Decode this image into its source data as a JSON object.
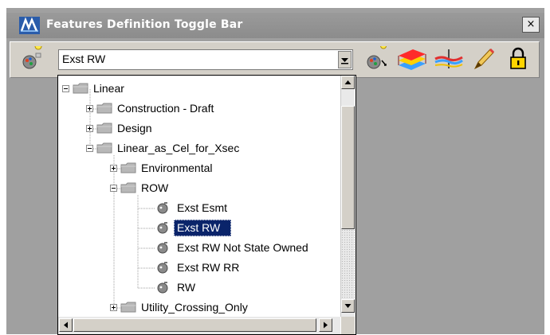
{
  "window": {
    "title": "Features Definition Toggle Bar",
    "close_label": "×"
  },
  "toolbar": {
    "feature_selector": {
      "value": "Exst RW"
    },
    "icons": [
      "feature-picker-icon",
      "feature-options-icon",
      "layers-icon",
      "cross-section-icon",
      "linear-pencil-icon",
      "lock-icon"
    ]
  },
  "tree": {
    "items": [
      {
        "label": "Linear",
        "type": "folder",
        "level": 0,
        "expander": "minus"
      },
      {
        "label": "Construction - Draft",
        "type": "folder",
        "level": 1,
        "expander": "plus"
      },
      {
        "label": "Design",
        "type": "folder",
        "level": 1,
        "expander": "plus"
      },
      {
        "label": "Linear_as_Cel_for_Xsec",
        "type": "folder",
        "level": 1,
        "expander": "minus"
      },
      {
        "label": "Environmental",
        "type": "folder",
        "level": 2,
        "expander": "plus"
      },
      {
        "label": "ROW",
        "type": "folder",
        "level": 2,
        "expander": "minus"
      },
      {
        "label": "Exst Esmt",
        "type": "feature",
        "level": 3
      },
      {
        "label": "Exst RW",
        "type": "feature",
        "level": 3,
        "selected": true
      },
      {
        "label": "Exst RW Not State Owned",
        "type": "feature",
        "level": 3
      },
      {
        "label": "Exst RW RR",
        "type": "feature",
        "level": 3
      },
      {
        "label": "RW",
        "type": "feature",
        "level": 3
      },
      {
        "label": "Utility_Crossing_Only",
        "type": "folder",
        "level": 2,
        "expander": "plus"
      }
    ]
  },
  "colors": {
    "selection": "#0a246a",
    "title_bar": "#8c8c8c",
    "toolbar": "#d4d0c8"
  }
}
